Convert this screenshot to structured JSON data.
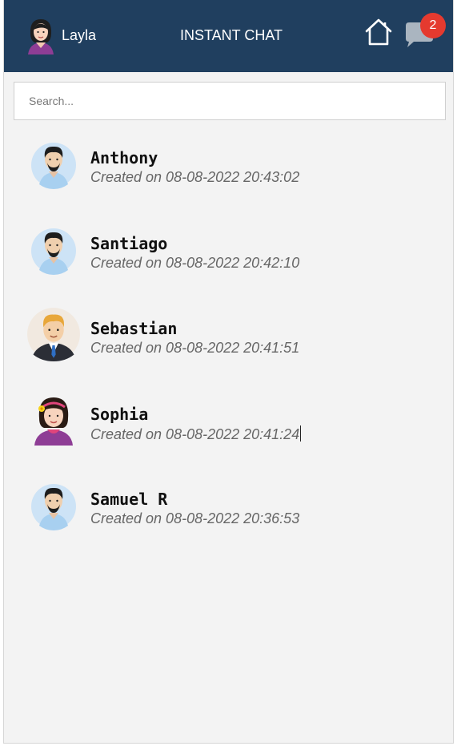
{
  "header": {
    "user_name": "Layla",
    "title": "INSTANT CHAT",
    "unread_count": "2"
  },
  "search": {
    "placeholder": "Search..."
  },
  "chats": [
    {
      "name": "Anthony",
      "created": "Created on 08-08-2022 20:43:02",
      "avatar": "man-beard-icon"
    },
    {
      "name": "Santiago",
      "created": "Created on 08-08-2022 20:42:10",
      "avatar": "man-beard-icon"
    },
    {
      "name": "Sebastian",
      "created": "Created on 08-08-2022 20:41:51",
      "avatar": "man-blond-suit-icon"
    },
    {
      "name": "Sophia",
      "created": "Created on 08-08-2022 20:41:24",
      "avatar": "woman-flower-icon"
    },
    {
      "name": "Samuel R",
      "created": "Created on 08-08-2022 20:36:53",
      "avatar": "man-beard-icon"
    }
  ],
  "colors": {
    "header_bg": "#203f5f",
    "badge": "#e53a2f",
    "background": "#f3f3f3"
  }
}
